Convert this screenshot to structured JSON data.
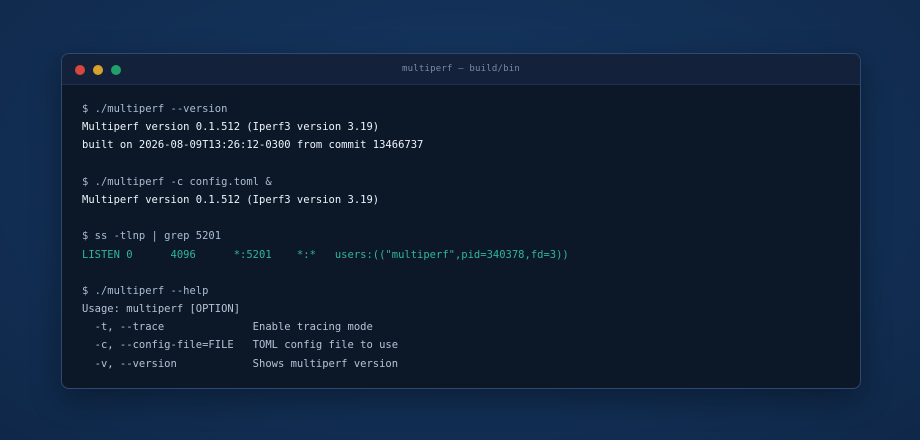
{
  "window": {
    "title": "multiperf — build/bin",
    "controls": {
      "close_color": "#d9463d",
      "minimize_color": "#d9a22a",
      "maximize_color": "#22a06b"
    }
  },
  "terminal": {
    "lines": [
      {
        "text": "$ ./multiperf --version",
        "style": "prompt"
      },
      {
        "text": "Multiperf version 0.1.512 (Iperf3 version 3.19)",
        "style": "bright"
      },
      {
        "text": "built on 2026-08-09T13:26:12-0300 from commit 13466737",
        "style": "bright"
      },
      {
        "text": "",
        "style": "blank"
      },
      {
        "text": "$ ./multiperf -c config.toml &",
        "style": "prompt"
      },
      {
        "text": "Multiperf version 0.1.512 (Iperf3 version 3.19)",
        "style": "bright"
      },
      {
        "text": "",
        "style": "blank"
      },
      {
        "text": "$ ss -tlnp | grep 5201",
        "style": "prompt"
      },
      {
        "text": "LISTEN 0      4096      *:5201    *:*   users:((\"multiperf\",pid=340378,fd=3))",
        "style": "green"
      },
      {
        "text": "",
        "style": "blank"
      },
      {
        "text": "$ ./multiperf --help",
        "style": "prompt"
      },
      {
        "text": "Usage: multiperf [OPTION]",
        "style": "muted"
      },
      {
        "text": "  -t, --trace              Enable tracing mode",
        "style": "muted"
      },
      {
        "text": "  -c, --config-file=FILE   TOML config file to use",
        "style": "muted"
      },
      {
        "text": "  -v, --version            Shows multiperf version",
        "style": "muted"
      }
    ]
  }
}
